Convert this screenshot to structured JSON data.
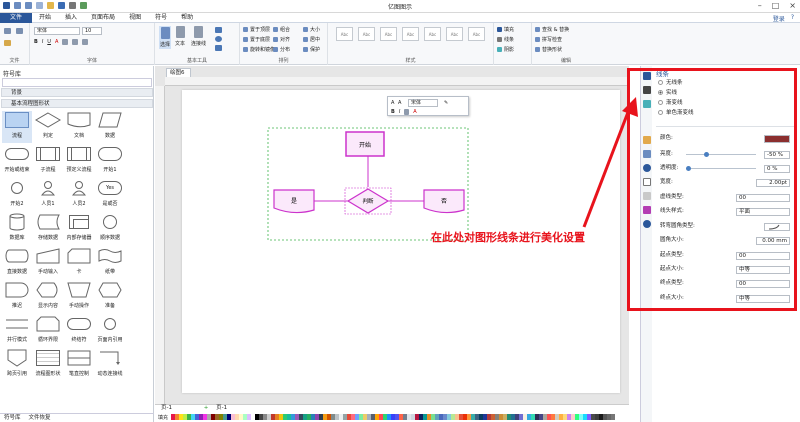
{
  "window": {
    "title": "亿图图示"
  },
  "menu": {
    "items": [
      "文件",
      "开始",
      "插入",
      "页面布局",
      "视图",
      "符号",
      "帮助"
    ],
    "right": [
      "登录",
      "?"
    ]
  },
  "ribbon": {
    "font_name": "宋体",
    "font_size": "10",
    "groups": {
      "file": "文件",
      "font": "字体",
      "basic_tools": "基本工具",
      "arrange": "排列",
      "style": "样式",
      "edit": "编辑"
    },
    "tools": {
      "select": "选择",
      "text": "文本",
      "connector": "连接线"
    },
    "arrange_buttons": [
      "置于顶层",
      "置于底层",
      "旋转和镜像",
      "组合",
      "对齐",
      "分布",
      "大小",
      "居中",
      "保护"
    ],
    "style_side": [
      "填充",
      "线条",
      "阴影"
    ],
    "edit_buttons": [
      "查找 & 替换",
      "拼写检查",
      "替换形状"
    ],
    "style_swatch": "Abc"
  },
  "library": {
    "title": "符号库",
    "sections": [
      "背景",
      "基本流程图形状"
    ],
    "shapes": [
      "流程",
      "判定",
      "文档",
      "数据",
      "开始或结束",
      "子流程",
      "预定义流程",
      "开始1",
      "开始2",
      "人员1",
      "人员2",
      "是或否",
      "数据库",
      "存储数据",
      "内部存储器",
      "顺序数据",
      "直接数据",
      "手动输入",
      "卡",
      "纸带",
      "推迟",
      "显示内容",
      "手动操作",
      "准备",
      "并行模式",
      "循环界限",
      "终结符",
      "页面内引用",
      "跨页引用",
      "流程图形状",
      "笔直控制",
      "动态连接线"
    ],
    "shape_yes_text": "Yes",
    "bottom_tabs": [
      "符号库",
      "文件恢复"
    ]
  },
  "canvas": {
    "tab": "绘图6",
    "page_tab": "页-1",
    "page_tab_bottom": "页-1",
    "fill_label": "填充",
    "context_font": "宋体",
    "diagram": {
      "start": "开始",
      "decision": "判断",
      "yes": "是",
      "no": "否"
    }
  },
  "panel": {
    "title": "线条",
    "line_options": [
      "无线条",
      "实线",
      "渐变线",
      "单色渐变线"
    ],
    "selected_option": "实线",
    "props": [
      {
        "label": "颜色:",
        "value": ""
      },
      {
        "label": "亮度:",
        "value": "-50 %"
      },
      {
        "label": "透明度:",
        "value": "0 %"
      },
      {
        "label": "宽度:",
        "value": "2.00pt"
      },
      {
        "label": "虚线类型:",
        "value": "00"
      },
      {
        "label": "线头样式:",
        "value": "平面"
      },
      {
        "label": "转弯圆角类型:",
        "value": ""
      },
      {
        "label": "圆角大小:",
        "value": "0.00 mm"
      },
      {
        "label": "起点类型:",
        "value": "00"
      },
      {
        "label": "起点大小:",
        "value": "中等"
      },
      {
        "label": "终点类型:",
        "value": "00"
      },
      {
        "label": "终点大小:",
        "value": "中等"
      }
    ],
    "line_color": "#8b2f2f"
  },
  "annotation": {
    "text": "在此处对图形线条进行美化设置"
  },
  "colors": {
    "accent": "#2b579a",
    "highlight": "#e8131c",
    "shape": "#cc33cc"
  }
}
